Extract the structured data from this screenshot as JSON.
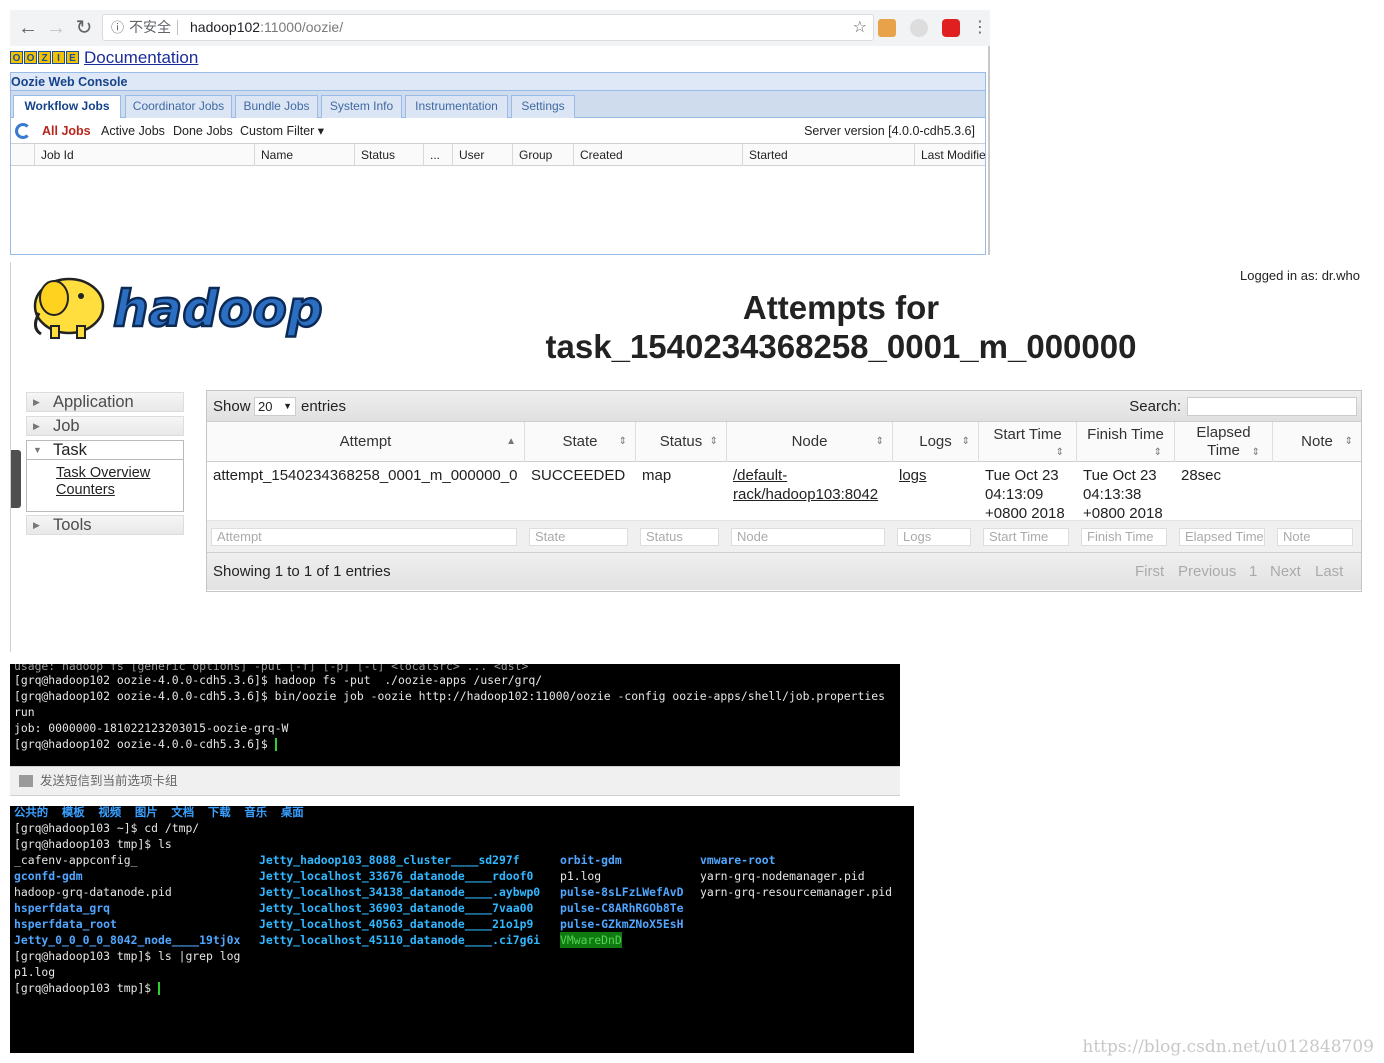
{
  "browser": {
    "insecure_label": "不安全",
    "url_host": "hadoop102",
    "url_rest": ":11000/oozie/",
    "icons": [
      "back-icon",
      "forward-icon",
      "reload-icon",
      "info-icon",
      "star-icon"
    ]
  },
  "oozie": {
    "logo_letters": [
      "O",
      "O",
      "Z",
      "I",
      "E"
    ],
    "doc_link": "Documentation",
    "console_title": "Oozie Web Console",
    "tabs": [
      "Workflow Jobs",
      "Coordinator Jobs",
      "Bundle Jobs",
      "System Info",
      "Instrumentation",
      "Settings"
    ],
    "filters": [
      "All Jobs",
      "Active Jobs",
      "Done Jobs",
      "Custom Filter ▾"
    ],
    "server_version": "Server version [4.0.0-cdh5.3.6]",
    "columns": [
      "Job Id",
      "Name",
      "Status",
      "...",
      "User",
      "Group",
      "Created",
      "Started",
      "Last Modifie"
    ]
  },
  "hadoop": {
    "logo_text": "hadoop",
    "logged_in": "Logged in as: dr.who",
    "title_line1": "Attempts for",
    "title_line2": "task_1540234368258_0001_m_000000",
    "nav": {
      "application": "Application",
      "job": "Job",
      "task": "Task",
      "task_overview": "Task Overview",
      "counters": "Counters",
      "tools": "Tools"
    },
    "table": {
      "show_label": "Show",
      "show_value": "20",
      "entries_label": "entries",
      "search_label": "Search:",
      "headers": [
        "Attempt",
        "State",
        "Status",
        "Node",
        "Logs",
        "Start Time",
        "Finish Time",
        "Elapsed Time",
        "Note"
      ],
      "row": {
        "attempt": "attempt_1540234368258_0001_m_000000_0",
        "state": "SUCCEEDED",
        "status": "map",
        "node_line1": "/default-",
        "node_line2": "rack/hadoop103:8042",
        "logs": "logs",
        "start_line1": "Tue Oct 23",
        "start_line2": "04:13:09",
        "start_line3": "+0800 2018",
        "finish_line1": "Tue Oct 23",
        "finish_line2": "04:13:38",
        "finish_line3": "+0800 2018",
        "elapsed": "28sec",
        "note": ""
      },
      "filter_placeholders": [
        "Attempt",
        "State",
        "Status",
        "Node",
        "Logs",
        "Start Time",
        "Finish Time",
        "Elapsed Time",
        "Note"
      ],
      "showing": "Showing 1 to 1 of 1 entries",
      "pager": [
        "First",
        "Previous",
        "1",
        "Next",
        "Last"
      ]
    }
  },
  "terminal1": {
    "lines": [
      "usage: hadoop fs [generic options] -put [-f] [-p] [-l] <localsrc> ... <dst>",
      "[grq@hadoop102 oozie-4.0.0-cdh5.3.6]$ hadoop fs -put  ./oozie-apps /user/grq/",
      "[grq@hadoop102 oozie-4.0.0-cdh5.3.6]$ bin/oozie job -oozie http://hadoop102:11000/oozie -config oozie-apps/shell/job.properties",
      "run",
      "job: 0000000-181022123203015-oozie-grq-W",
      "[grq@hadoop102 oozie-4.0.0-cdh5.3.6]$ "
    ]
  },
  "send_bar": "发送短信到当前选项卡组",
  "terminal2": {
    "header_dirs": "公共的  模板  视频  图片  文档  下载  音乐  桌面",
    "cmd1": "[grq@hadoop103 ~]$ cd /tmp/",
    "cmd2": "[grq@hadoop103 tmp]$ ls",
    "col1": [
      "_cafenv-appconfig_",
      "gconfd-gdm",
      "hadoop-grq-datanode.pid",
      "hsperfdata_grq",
      "hsperfdata_root",
      "Jetty_0_0_0_0_8042_node____19tj0x"
    ],
    "col2": [
      "Jetty_hadoop103_8088_cluster____sd297f",
      "Jetty_localhost_33676_datanode____rdoof0",
      "Jetty_localhost_34138_datanode____.aybwp0",
      "Jetty_localhost_36903_datanode____7vaa00",
      "Jetty_localhost_40563_datanode____21o1p9",
      "Jetty_localhost_45110_datanode____.ci7g6i"
    ],
    "col3": [
      "orbit-gdm",
      "p1.log",
      "pulse-8sLFzLWefAvD",
      "pulse-C8ARhRGOb8Te",
      "pulse-GZkmZNoX5EsH",
      "VMwareDnD"
    ],
    "col4": [
      "vmware-root",
      "yarn-grq-nodemanager.pid",
      "yarn-grq-resourcemanager.pid"
    ],
    "cmd3": "[grq@hadoop103 tmp]$ ls |grep log",
    "out3": "p1.log",
    "cmd4": "[grq@hadoop103 tmp]$ "
  },
  "watermark": "https://blog.csdn.net/u012848709"
}
